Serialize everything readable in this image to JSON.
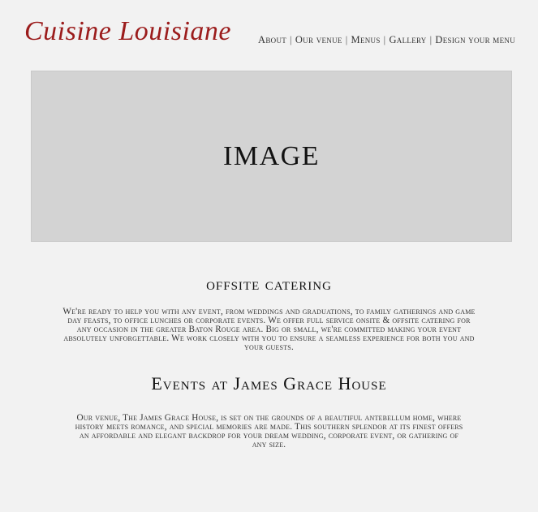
{
  "brand": {
    "logo_text": "Cuisine Louisiane",
    "logo_color": "#9b1c1c"
  },
  "nav": {
    "items": [
      "About",
      "Our venue",
      "Menus",
      "Gallery",
      "Design your menu"
    ],
    "separator": "|"
  },
  "hero": {
    "label": "IMAGE"
  },
  "sections": [
    {
      "title": "offsite catering",
      "body": "We're ready to help you with any event, from weddings and graduations, to family gatherings and game day feasts, to office lunches or corporate events. We offer full service onsite & offsite catering for any occasion in the greater Baton Rouge area. Big or small, we're committed making your event absolutely unforgettable. We work closely with you to ensure a seamless experience for both you and your guests."
    },
    {
      "title": "Events at James Grace House",
      "body": "Our venue, The James Grace House, is set on the grounds of a beautiful antebellum home, where history meets romance, and special memories are made. This southern splendor at its finest offers an affordable and elegant backdrop for your dream wedding, corporate event, or gathering of any size."
    }
  ]
}
